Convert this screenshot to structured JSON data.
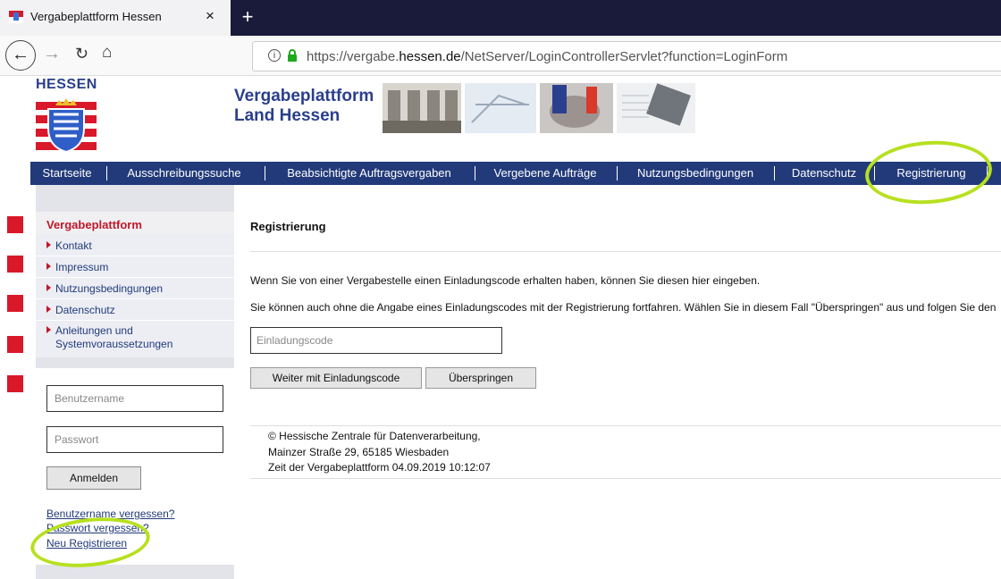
{
  "browser": {
    "tab_title": "Vergabeplattform Hessen",
    "tab_close": "×",
    "new_tab": "+",
    "back": "←",
    "forward": "→",
    "reload": "↻",
    "home": "⌂",
    "url_info": "i",
    "url_prefix": "https://vergabe.",
    "url_domain": "hessen.de",
    "url_path": "/NetServer/LoginControllerServlet?function=LoginForm"
  },
  "header": {
    "state_name": "HESSEN",
    "title_line1": "Vergabeplattform",
    "title_line2": "Land Hessen"
  },
  "nav": {
    "items": [
      "Startseite",
      "Ausschreibungssuche",
      "Beabsichtigte Auftragsvergaben",
      "Vergebene Aufträge",
      "Nutzungsbedingungen",
      "Datenschutz",
      "Registrierung"
    ]
  },
  "sidebar": {
    "heading": "Vergabeplattform",
    "links": [
      "Kontakt",
      "Impressum",
      "Nutzungsbedingungen",
      "Datenschutz",
      "Anleitungen und",
      "Systemvoraussetzungen"
    ],
    "username_placeholder": "Benutzername",
    "password_placeholder": "Passwort",
    "login_label": "Anmelden",
    "forgot_username": "Benutzername vergessen?",
    "forgot_password": "Passwort vergessen?",
    "register": "Neu Registrieren"
  },
  "main": {
    "title": "Registrierung",
    "para1": "Wenn Sie von einer Vergabestelle einen Einladungscode erhalten haben, können Sie diesen hier eingeben.",
    "para2": "Sie können auch ohne die Angabe eines Einladungscodes mit der Registrierung fortfahren. Wählen Sie in diesem Fall \"Überspringen\" aus und folgen Sie den",
    "code_placeholder": "Einladungscode",
    "btn_continue": "Weiter mit Einladungscode",
    "btn_skip": "Überspringen"
  },
  "footer": {
    "line1": "© Hessische Zentrale für Datenverarbeitung,",
    "line2": "Mainzer Straße 29, 65185 Wiesbaden",
    "line3": "Zeit der Vergabeplattform 04.09.2019 10:12:07"
  },
  "colors": {
    "nav_blue": "#223a7a",
    "accent_red": "#c0182a",
    "highlight_green": "#b7e01f"
  }
}
